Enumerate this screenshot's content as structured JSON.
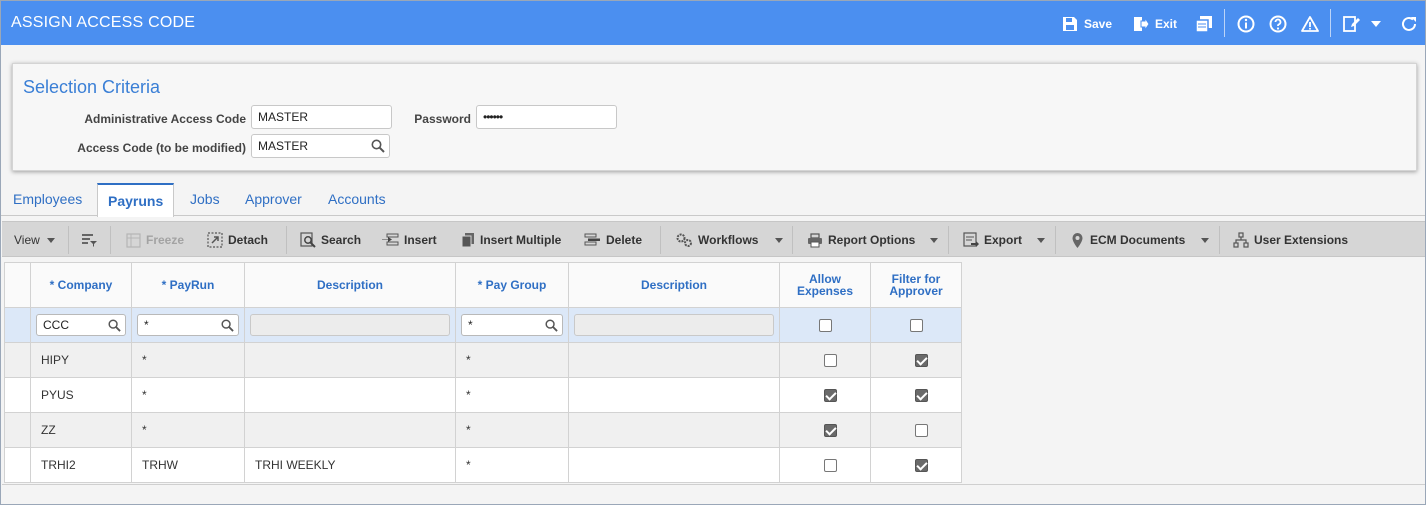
{
  "window": {
    "title": "ASSIGN ACCESS CODE"
  },
  "titlebar": {
    "save_label": "Save",
    "exit_label": "Exit",
    "icons": [
      "save-icon",
      "exit-icon",
      "copy-icon",
      "info-icon",
      "help-icon",
      "warning-icon",
      "edit-icon",
      "refresh-icon"
    ]
  },
  "criteria": {
    "heading": "Selection Criteria",
    "admin_code_label": "Administrative Access Code",
    "admin_code_value": "MASTER",
    "password_label": "Password",
    "password_value": "••••••",
    "access_code_label": "Access Code (to be modified)",
    "access_code_value": "MASTER"
  },
  "tabs": [
    {
      "label": "Employees",
      "active": false
    },
    {
      "label": "Payruns",
      "active": true
    },
    {
      "label": "Jobs",
      "active": false
    },
    {
      "label": "Approver",
      "active": false
    },
    {
      "label": "Accounts",
      "active": false
    }
  ],
  "toolbar": {
    "view": "View",
    "freeze": "Freeze",
    "detach": "Detach",
    "search": "Search",
    "insert": "Insert",
    "insert_multiple": "Insert Multiple",
    "delete": "Delete",
    "workflows": "Workflows",
    "report_options": "Report Options",
    "export": "Export",
    "ecm_documents": "ECM Documents",
    "user_extensions": "User Extensions"
  },
  "grid": {
    "columns": {
      "company": "* Company",
      "payrun": "* PayRun",
      "description1": "Description",
      "pay_group": "* Pay Group",
      "description2": "Description",
      "allow_expenses_1": "Allow",
      "allow_expenses_2": "Expenses",
      "filter_approver_1": "Filter for",
      "filter_approver_2": "Approver"
    },
    "filter": {
      "company": "CCC",
      "payrun": "*",
      "description1": "",
      "pay_group": "*",
      "description2": "",
      "allow_expenses": false,
      "filter_approver": false
    },
    "rows": [
      {
        "company": "HIPY",
        "payrun": "*",
        "description1": "",
        "pay_group": "*",
        "description2": "",
        "allow_expenses": false,
        "filter_approver": true
      },
      {
        "company": "PYUS",
        "payrun": "*",
        "description1": "",
        "pay_group": "*",
        "description2": "",
        "allow_expenses": true,
        "filter_approver": true
      },
      {
        "company": "ZZ",
        "payrun": "*",
        "description1": "",
        "pay_group": "*",
        "description2": "",
        "allow_expenses": true,
        "filter_approver": false
      },
      {
        "company": "TRHI2",
        "payrun": "TRHW",
        "description1": "TRHI WEEKLY",
        "pay_group": "*",
        "description2": "",
        "allow_expenses": false,
        "filter_approver": true
      }
    ]
  }
}
